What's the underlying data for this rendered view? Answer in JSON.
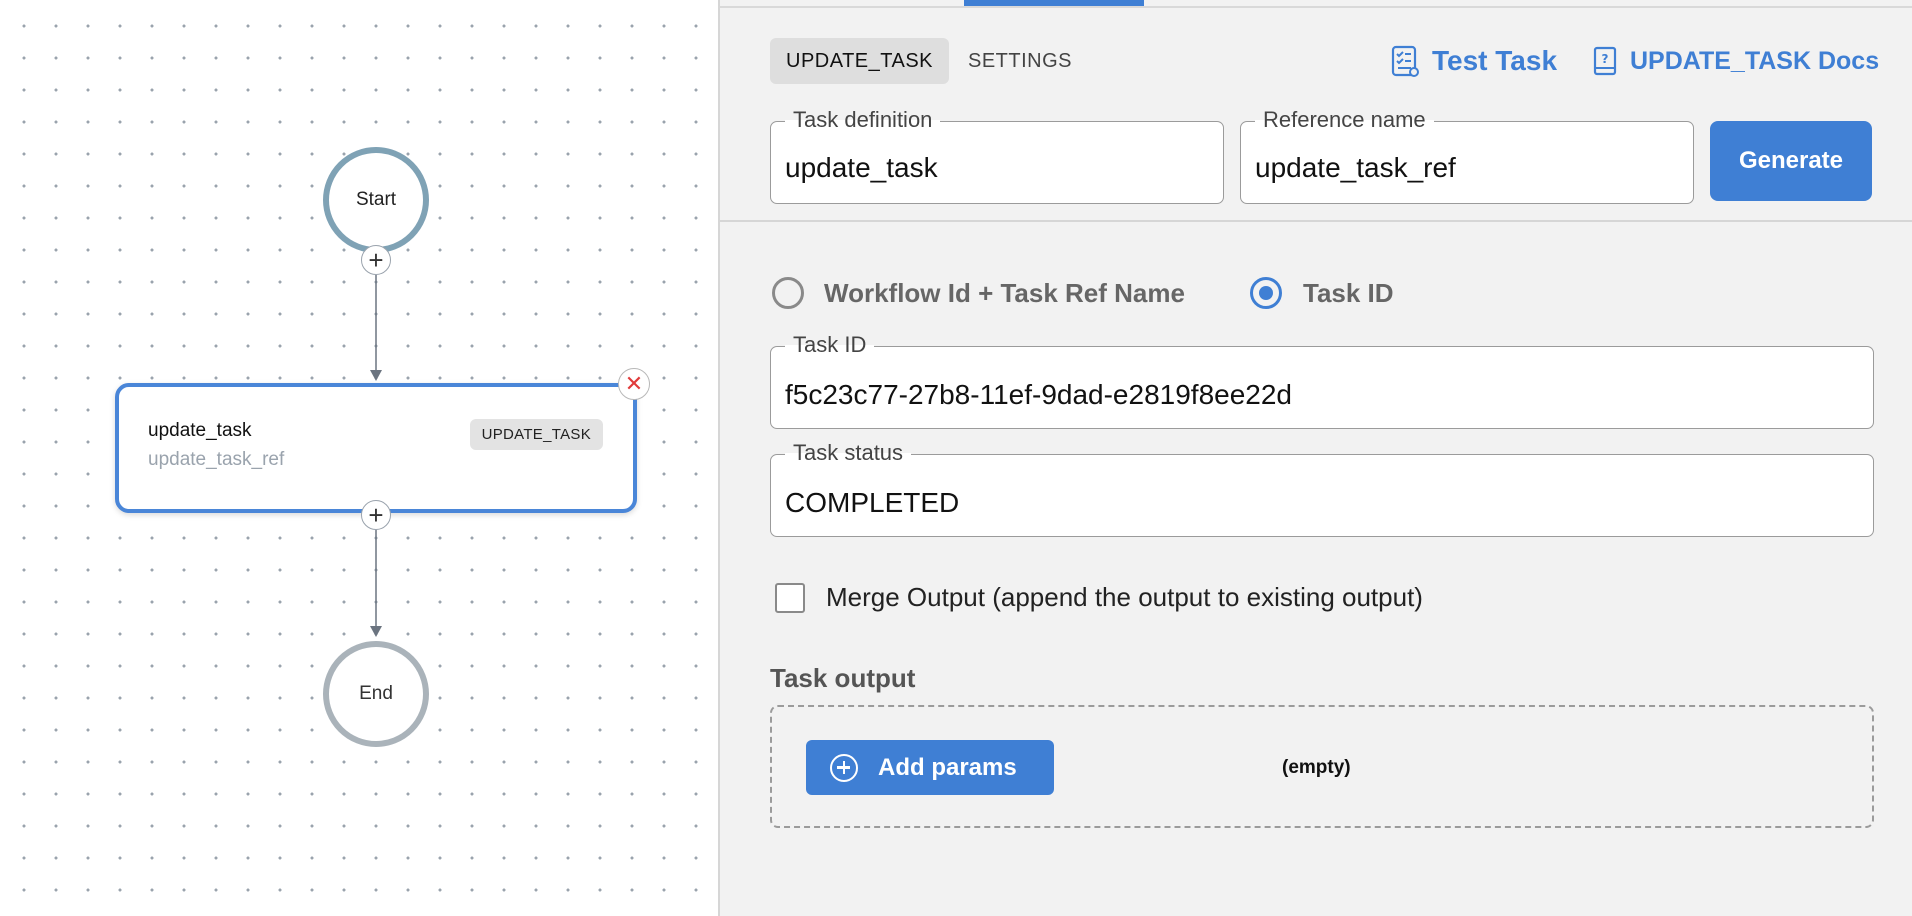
{
  "canvas": {
    "start_label": "Start",
    "end_label": "End",
    "add_symbol": "+",
    "close_symbol": "✕",
    "task_node": {
      "name": "update_task",
      "reference": "update_task_ref",
      "type_badge": "UPDATE_TASK"
    }
  },
  "panel": {
    "tabs": [
      {
        "label": "UPDATE_TASK",
        "active": true
      },
      {
        "label": "SETTINGS",
        "active": false
      }
    ],
    "links": {
      "test_task": "Test Task",
      "docs": "UPDATE_TASK Docs"
    },
    "task_definition": {
      "label": "Task definition",
      "value": "update_task"
    },
    "reference_name": {
      "label": "Reference name",
      "value": "update_task_ref"
    },
    "generate_label": "Generate",
    "radio_options": [
      {
        "label": "Workflow Id + Task Ref Name",
        "selected": false
      },
      {
        "label": "Task ID",
        "selected": true
      }
    ],
    "task_id": {
      "label": "Task ID",
      "value": "f5c23c77-27b8-11ef-9dad-e2819f8ee22d"
    },
    "task_status": {
      "label": "Task status",
      "value": "COMPLETED"
    },
    "merge_output": {
      "label": "Merge Output (append the output to existing output)",
      "checked": false
    },
    "task_output": {
      "title": "Task output",
      "add_params_label": "Add params",
      "empty_label": "(empty)"
    }
  },
  "colors": {
    "accent": "#3f7fd4",
    "start_ring": "#7fa2b5",
    "end_ring": "#aab3ba",
    "close_red": "#e03b3b"
  }
}
